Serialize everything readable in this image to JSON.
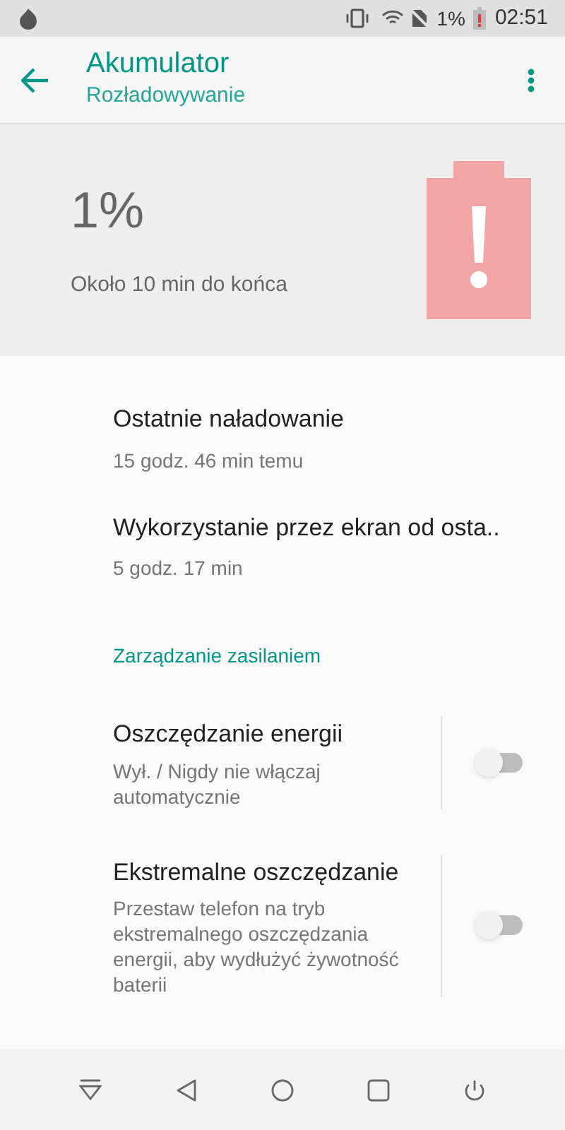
{
  "status_bar": {
    "battery": "1%",
    "time": "02:51"
  },
  "app_bar": {
    "title": "Akumulator",
    "subtitle": "Rozładowywanie"
  },
  "battery_header": {
    "percent": "1%",
    "estimate": "Około 10 min do końca"
  },
  "items": [
    {
      "kind": "info",
      "title": "Ostatnie naładowanie",
      "summary": "15 godz. 46 min temu"
    },
    {
      "kind": "info",
      "title": "Wykorzystanie przez ekran od osta..",
      "summary": "5 godz. 17 min"
    },
    {
      "kind": "header",
      "title": "Zarządzanie zasilaniem"
    },
    {
      "kind": "toggle",
      "title": "Oszczędzanie energii",
      "summary": "Wył. / Nigdy nie włączaj automatycznie",
      "on": false
    },
    {
      "kind": "toggle",
      "title": "Ekstremalne oszczędzanie",
      "summary": "Przestaw telefon na tryb ekstremalnego oszczędzania energii, aby wydłużyć żywotność baterii",
      "on": false
    }
  ]
}
